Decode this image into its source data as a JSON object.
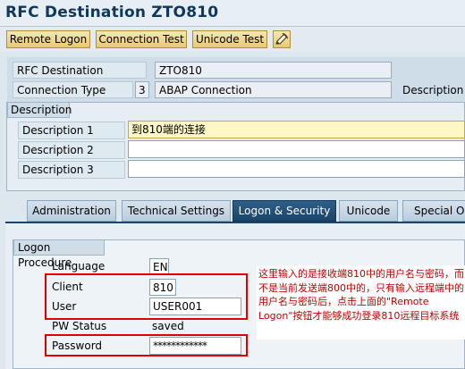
{
  "title": "RFC Destination ZTO810",
  "toolbar": {
    "remote_logon": "Remote Logon",
    "connection_test": "Connection Test",
    "unicode_test": "Unicode Test",
    "tool_icon": "edit-icon"
  },
  "header": {
    "rfc_destination_label": "RFC Destination",
    "rfc_destination_value": "ZTO810",
    "connection_type_label": "Connection Type",
    "connection_type_code": "3",
    "connection_type_value": "ABAP Connection",
    "description_label": "Description"
  },
  "description_group": {
    "title": "Description",
    "desc1_label": "Description 1",
    "desc1_value": "到810端的连接",
    "desc2_label": "Description 2",
    "desc2_value": "",
    "desc3_label": "Description 3",
    "desc3_value": ""
  },
  "tabs": [
    {
      "label": "Administration"
    },
    {
      "label": "Technical Settings"
    },
    {
      "label": "Logon & Security"
    },
    {
      "label": "Unicode"
    },
    {
      "label": "Special Op"
    }
  ],
  "logon": {
    "title": "Logon Procedure",
    "language_label": "Language",
    "language_value": "EN",
    "client_label": "Client",
    "client_value": "810",
    "user_label": "User",
    "user_value": "USER001",
    "pw_status_label": "PW Status",
    "pw_status_value": "saved",
    "password_label": "Password",
    "password_value": "************"
  },
  "annotation": "这里输入的是接收端810中的用户名与密码，而不是当前发送端800中的，只有输入远程端中的用户名与密码后，点击上面的\"Remote Logon\"按钮才能够成功登录810远程目标系统",
  "colors": {
    "accent": "#1c4468",
    "highlight_box": "#e00000",
    "note_text": "#c00000"
  }
}
